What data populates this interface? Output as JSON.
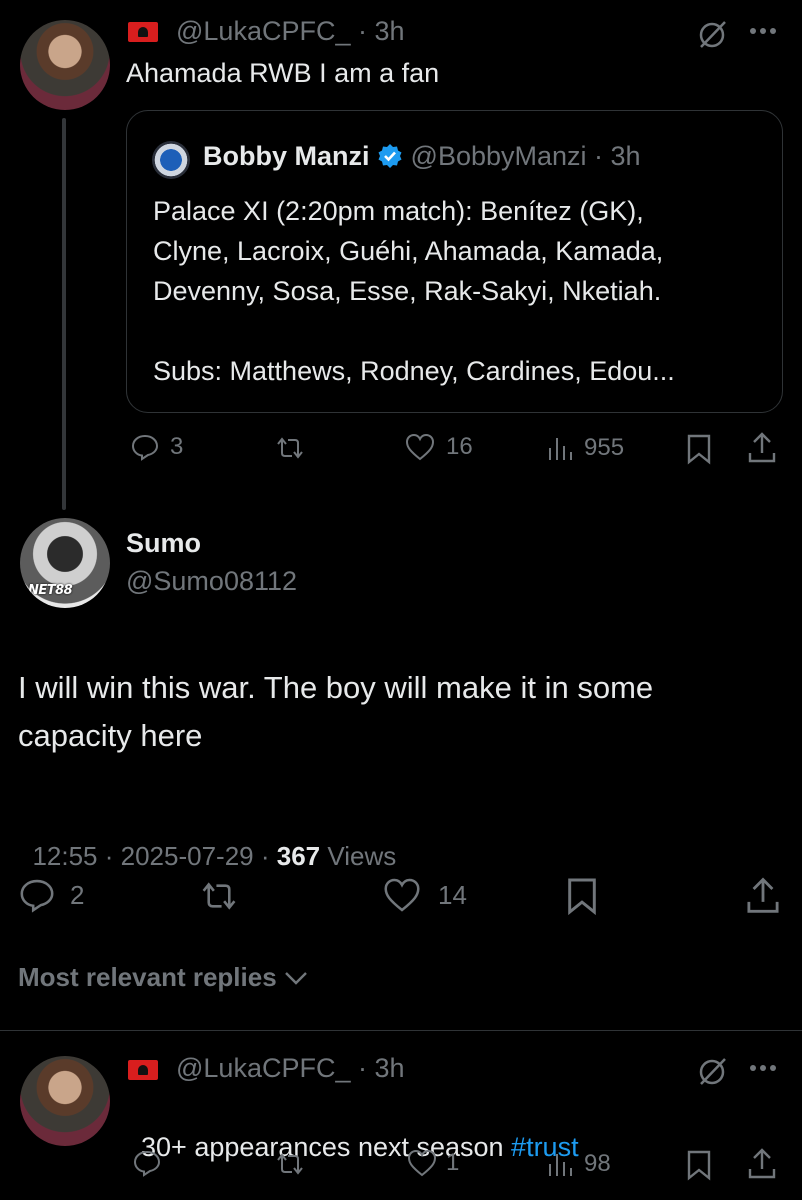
{
  "reply1": {
    "handle": "@LukaCPFC_",
    "dot_time": "· 3h",
    "text": "Ahamada RWB I am a fan",
    "quote": {
      "name": "Bobby Manzi",
      "handle": "@BobbyManzi",
      "dot_time": "· 3h",
      "line1": "Palace XI (2:20pm match): Benítez (GK),",
      "line2": "Clyne, Lacroix, Guéhi, Ahamada, Kamada,",
      "line3": "Devenny, Sosa, Esse, Rak-Sakyi, Nketiah.",
      "line4": "Subs: Matthews, Rodney, Cardines, Edou..."
    },
    "actions": {
      "replies": "3",
      "likes": "16",
      "views": "955"
    }
  },
  "main": {
    "name": "Sumo",
    "handle": "@Sumo08112",
    "avatar_watermark": "NET88",
    "line1": "I will win this war. The boy will make it in some",
    "line2": "capacity here",
    "time": "12:55 · 2025-07-29 · ",
    "views_count": "367",
    "views_label": " Views",
    "actions": {
      "replies": "2",
      "likes": "14"
    }
  },
  "sort_label": "Most relevant replies",
  "reply2": {
    "handle": "@LukaCPFC_",
    "dot_time": "· 3h",
    "text": "30+ appearances next season ",
    "hashtag": "#trust",
    "actions": {
      "likes": "1",
      "views": "98"
    }
  },
  "colors": {
    "accent": "#1d9bf0",
    "muted": "#71767b",
    "text": "#e7e9ea",
    "border": "#2f3336"
  }
}
